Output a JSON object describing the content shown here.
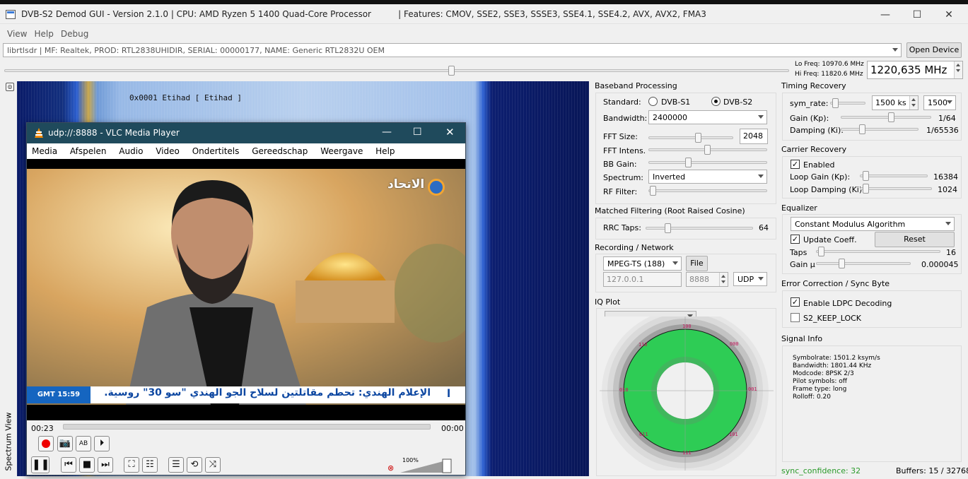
{
  "window": {
    "title": "DVB-S2 Demod GUI - Version 2.1.0 | CPU: AMD Ryzen 5 1400 Quad-Core Processor          | Features: CMOV, SSE2, SSE3, SSSE3, SSE4.1, SSE4.2, AVX, AVX2, FMA3",
    "minimize": "—",
    "maximize": "☐",
    "close": "✕"
  },
  "menu": {
    "view": "View",
    "help": "Help",
    "debug": "Debug"
  },
  "device": {
    "selected": "librtlsdr | MF: Realtek, PROD: RTL2838UHIDIR, SERIAL: 00000177, NAME: Generic RTL2832U OEM",
    "open_button": "Open Device"
  },
  "freq": {
    "lo": "Lo Freq: 10970.6 MHz",
    "hi": "Hi Freq: 11820.6 MHz",
    "value": "1220,635 MHz",
    "slider_position": 0.57
  },
  "spectrum": {
    "side_label": "Spectrum View",
    "overlay_text": "0x0001 Etihad [ Etihad ]"
  },
  "vlc": {
    "title": "udp://:8888 - VLC Media Player",
    "menu": [
      "Media",
      "Afspelen",
      "Audio",
      "Video",
      "Ondertitels",
      "Gereedschap",
      "Weergave",
      "Help"
    ],
    "time_elapsed": "00:23",
    "time_total": "00:00",
    "volume": "100%",
    "channel_logo": "الاتحاد",
    "ticker_time": "GMT 15:59",
    "ticker_text": "الإعلام الهندي: تحطم مقاتلتين لسلاح الجو الهندي \"سو 30\" روسية.",
    "ticker_marker": "ا"
  },
  "baseband": {
    "title": "Baseband Processing",
    "standard_label": "Standard:",
    "std_s1": "DVB-S1",
    "std_s2": "DVB-S2",
    "bandwidth_label": "Bandwidth:",
    "bandwidth": "2400000",
    "fft_size_label": "FFT Size:",
    "fft_size": "2048",
    "fft_intens_label": "FFT Intens.",
    "bb_gain_label": "BB Gain:",
    "spectrum_label": "Spectrum:",
    "spectrum": "Inverted",
    "rf_filter_label": "RF Filter:"
  },
  "matched": {
    "title": "Matched Filtering (Root Raised Cosine)",
    "rrc_label": "RRC Taps:",
    "rrc_value": "64"
  },
  "recording": {
    "title": "Recording / Network",
    "format": "MPEG-TS (188)",
    "file_button": "File",
    "ip": "127.0.0.1",
    "port": "8888",
    "protocol": "UDP"
  },
  "iq": {
    "title": "IQ Plot",
    "symbols": [
      "100",
      "110",
      "000",
      "010",
      "001",
      "011",
      "101",
      "111"
    ]
  },
  "timing": {
    "title": "Timing Recovery",
    "sym_rate_label": "sym_rate:",
    "sym_rate": "1500 ks",
    "sym_rate2": "1500",
    "gain_label": "Gain (Kp):",
    "gain_value": "1/64",
    "damping_label": "Damping (Ki):",
    "damping_value": "1/65536"
  },
  "carrier": {
    "title": "Carrier Recovery",
    "enabled": "Enabled",
    "loop_gain_label": "Loop Gain (Kp):",
    "loop_gain_value": "16384",
    "loop_damping_label": "Loop Damping (Ki):",
    "loop_damping_value": "1024"
  },
  "equalizer": {
    "title": "Equalizer",
    "algorithm": "Constant Modulus Algorithm",
    "update_coeff": "Update Coeff.",
    "reset": "Reset",
    "taps_label": "Taps",
    "taps_value": "16",
    "gain_label": "Gain µ",
    "gain_value": "0.000045"
  },
  "errorcorr": {
    "title": "Error Correction / Sync Byte",
    "ldpc": "Enable LDPC Decoding",
    "s2keep": "S2_KEEP_LOCK"
  },
  "signal": {
    "title": "Signal Info",
    "lines": [
      "Symbolrate: 1501.2 ksym/s",
      "Bandwidth: 1801.44 KHz",
      "Modcode: 8PSK 2/3",
      "Pilot symbols: off",
      "Frame type: long",
      "Rolloff: 0.20"
    ]
  },
  "status": {
    "sync": "sync_confidence: 32",
    "buffers": "Buffers: 15 / 32768"
  },
  "colors": {
    "vlc_title": "#1f4a5c",
    "ticker_blue": "#1565c0",
    "iq_green": "#2ecc55",
    "sync_green": "#2a9a2a"
  }
}
